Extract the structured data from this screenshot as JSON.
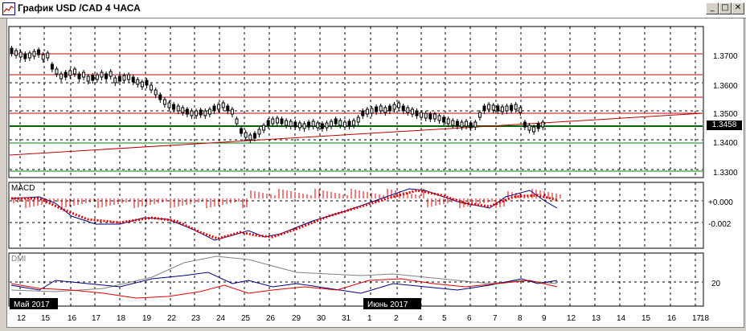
{
  "window": {
    "title": "График USD /CAD  4 ЧАСА",
    "minimize_label": "_",
    "maximize_label": "□",
    "close_label": "✕"
  },
  "price_axis": {
    "ticks": [
      "1.3700",
      "1.3600",
      "1.3500",
      "1.3400",
      "1.3300"
    ],
    "current_price": "1.3458"
  },
  "macd_panel": {
    "label": "MACD",
    "ticks": [
      "+0.000",
      "-0.002"
    ]
  },
  "dmi_panel": {
    "label": "DMI",
    "ticks": [
      "20"
    ]
  },
  "time_axis": {
    "labels": [
      "12",
      "15",
      "16",
      "17",
      "18",
      "19",
      "22",
      "23",
      "24",
      "25",
      "26",
      "29",
      "30",
      "31",
      "1",
      "2",
      "4",
      "5",
      "6",
      "7",
      "8",
      "9",
      "12",
      "13",
      "14",
      "15",
      "16",
      "17",
      "18"
    ],
    "month_marks": [
      "Май 2017",
      "Июнь 2017"
    ]
  },
  "colors": {
    "candle": "#000000",
    "support_red": "#c00000",
    "level_green": "#006400",
    "macd_signal": "#e00000",
    "macd_line": "#000080",
    "dmi_plus": "#000080",
    "dmi_minus": "#e00000",
    "adx": "#808080"
  }
}
